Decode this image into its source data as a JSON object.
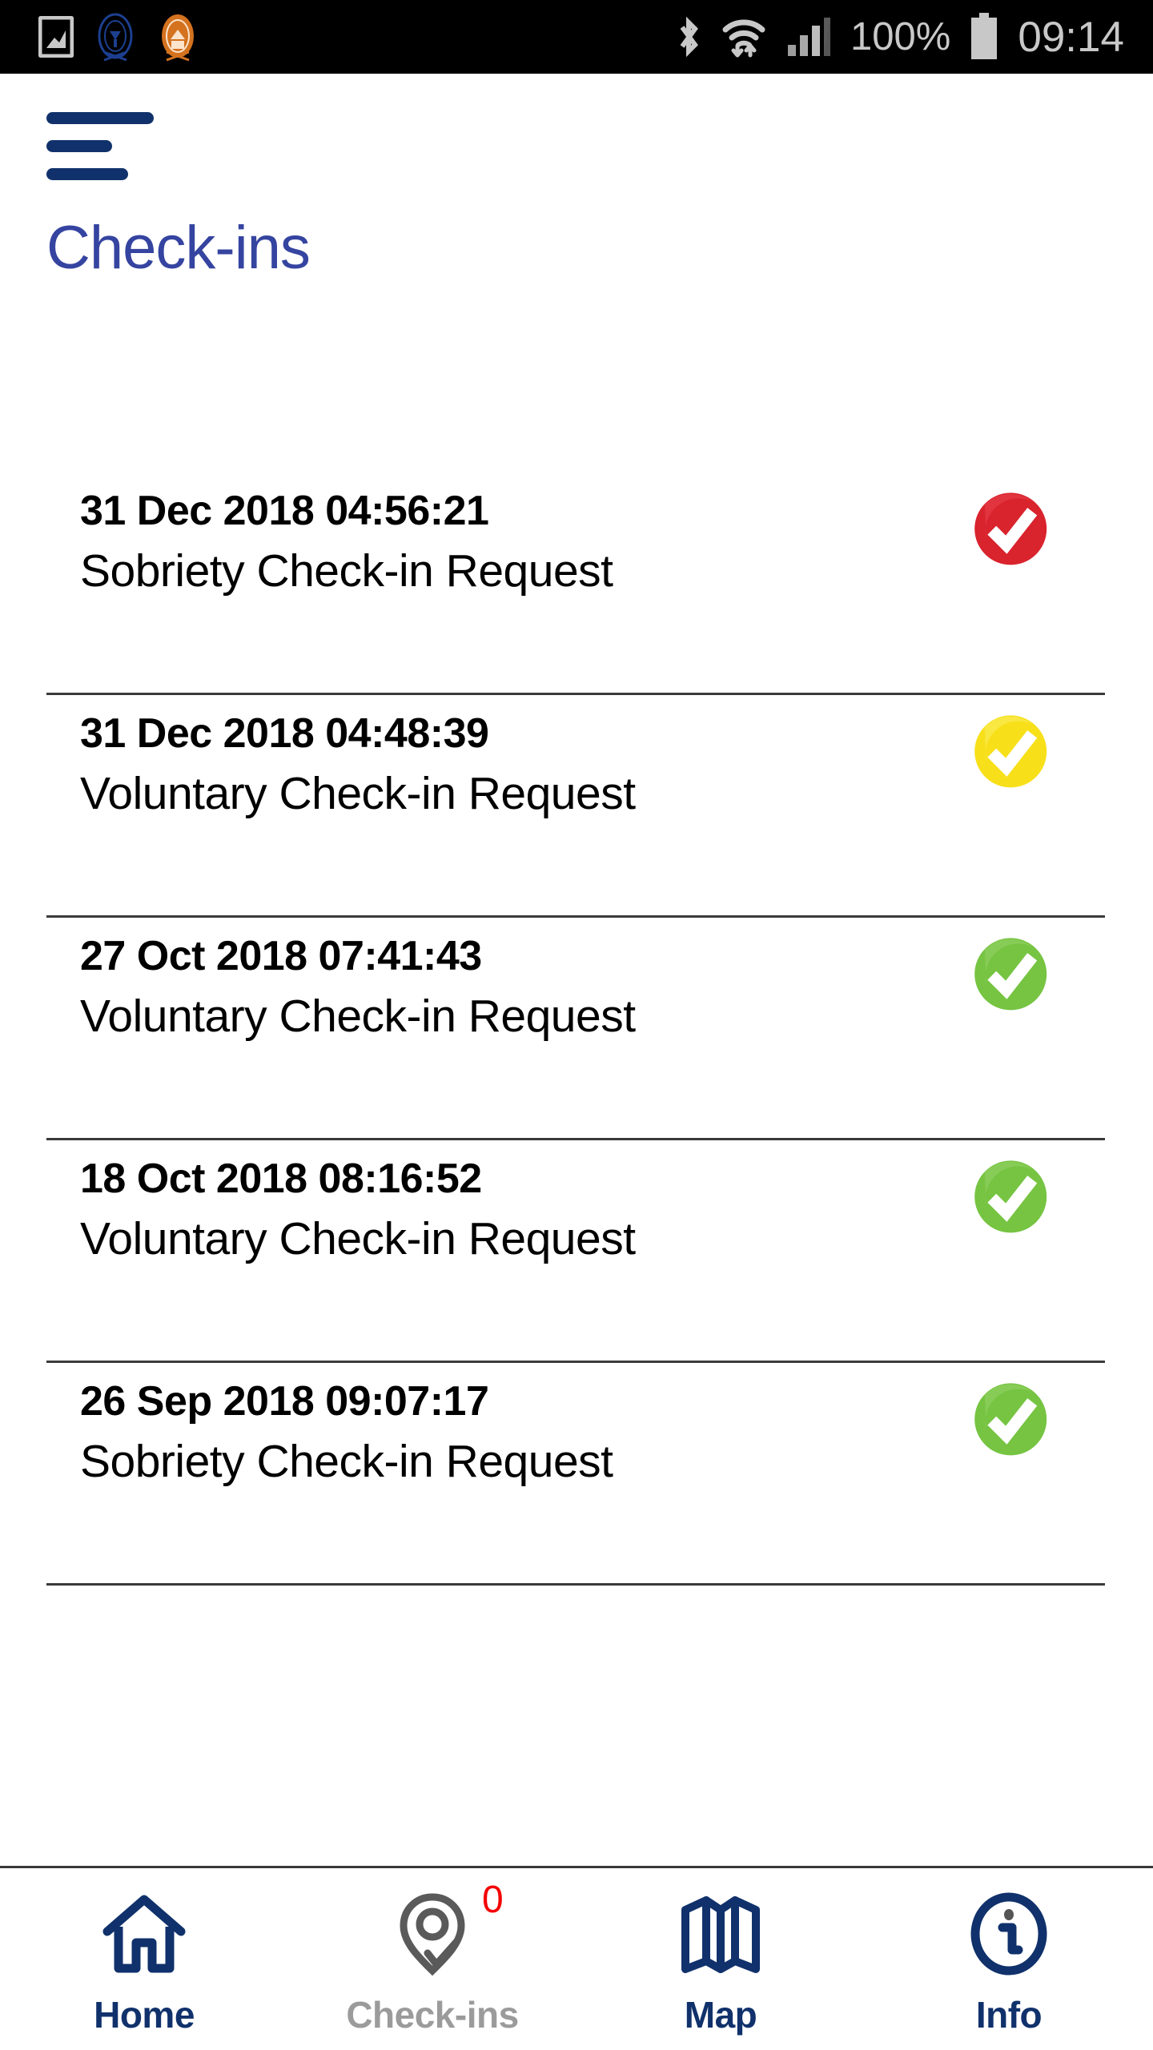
{
  "statusbar": {
    "left_icons": [
      "gallery-icon",
      "crest-blue-icon",
      "crest-orange-icon"
    ],
    "right_icons": [
      "bluetooth-icon",
      "wifi-icon",
      "signal-icon",
      "battery-icon"
    ],
    "battery_label": "100%",
    "clock": "09:14"
  },
  "appbar": {
    "menu_icon": "hamburger-menu-icon",
    "title": "Check-ins"
  },
  "colors": {
    "navy": "#10316b",
    "title_blue": "#3544a0",
    "badge_red": "#f40000",
    "status_red": "#d9232d",
    "status_yellow": "#f7e01a",
    "status_green": "#76c442",
    "muted_grey": "#9b9b9b",
    "divider": "#3a3a3a"
  },
  "list": {
    "items": [
      {
        "date": "31 Dec 2018  04:56:21",
        "title": "Sobriety Check-in Request",
        "status": "red",
        "status_icon": "check-sticker-red-icon"
      },
      {
        "date": "31 Dec 2018  04:48:39",
        "title": "Voluntary Check-in Request",
        "status": "yellow",
        "status_icon": "check-sticker-yellow-icon"
      },
      {
        "date": "27 Oct 2018  07:41:43",
        "title": "Voluntary Check-in Request",
        "status": "green",
        "status_icon": "check-sticker-green-icon"
      },
      {
        "date": "18 Oct 2018  08:16:52",
        "title": "Voluntary Check-in Request",
        "status": "green",
        "status_icon": "check-sticker-green-icon"
      },
      {
        "date": "26 Sep 2018  09:07:17",
        "title": "Sobriety Check-in Request",
        "status": "green",
        "status_icon": "check-sticker-green-icon"
      }
    ]
  },
  "tabbar": {
    "items": [
      {
        "label": "Home",
        "icon": "home-icon",
        "active": true,
        "badge": ""
      },
      {
        "label": "Check-ins",
        "icon": "map-pin-check-icon",
        "active": false,
        "badge": "0"
      },
      {
        "label": "Map",
        "icon": "map-icon",
        "active": true,
        "badge": ""
      },
      {
        "label": "Info",
        "icon": "info-circle-icon",
        "active": true,
        "badge": ""
      }
    ]
  }
}
